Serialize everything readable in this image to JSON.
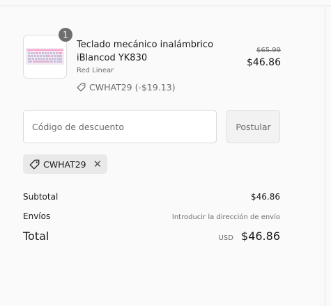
{
  "product": {
    "quantity": "1",
    "name": "Teclado mecánico inalámbrico iBlancod YK830",
    "variant": "Red Linear",
    "discount_tag": "CWHAT29 (-$19.13)",
    "original_price": "$65.99",
    "price": "$46.86",
    "image_icon": "keyboard-image"
  },
  "discount": {
    "placeholder": "Código de descuento",
    "apply_label": "Postular",
    "applied_code": "CWHAT29"
  },
  "summary": {
    "subtotal_label": "Subtotal",
    "subtotal_value": "$46.86",
    "shipping_label": "Envíos",
    "shipping_value": "Introducir la dirección de envío",
    "total_label": "Total",
    "currency": "USD",
    "total_value": "$46.86"
  }
}
